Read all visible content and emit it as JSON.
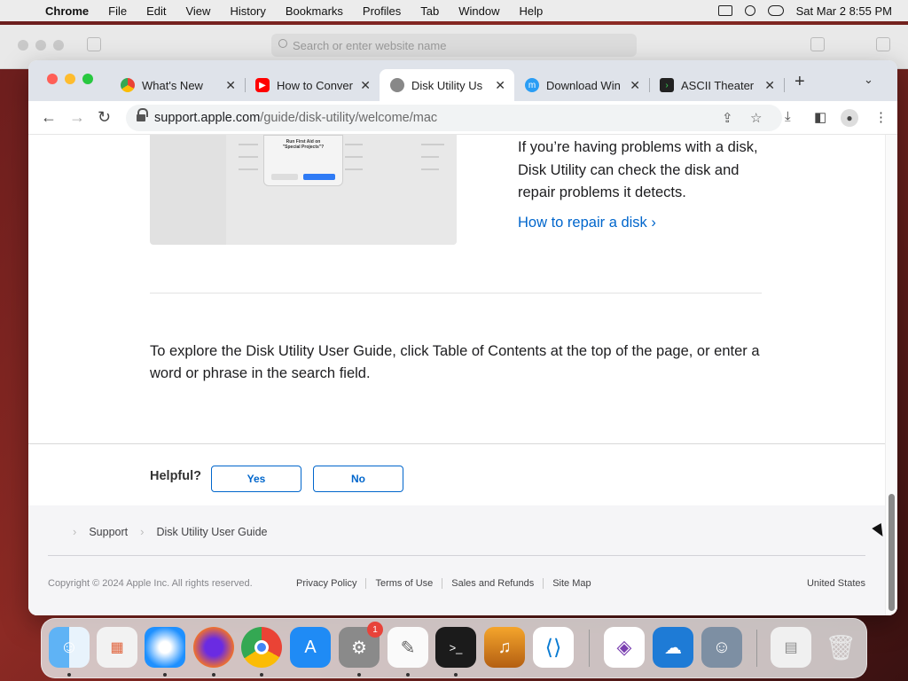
{
  "menubar": {
    "app_name": "Chrome",
    "items": [
      "File",
      "Edit",
      "View",
      "History",
      "Bookmarks",
      "Profiles",
      "Tab",
      "Window",
      "Help"
    ],
    "clock": "Sat Mar 2  8:55 PM"
  },
  "safari": {
    "address_placeholder": "Search or enter website name"
  },
  "tabs": [
    {
      "title": "What's New",
      "icon": "chrome-icon",
      "active": false
    },
    {
      "title": "How to Conver",
      "icon": "youtube-icon",
      "active": false
    },
    {
      "title": "Disk Utility Us",
      "icon": "apple-icon",
      "active": true
    },
    {
      "title": "Download Win",
      "icon": "mu-icon",
      "active": false
    },
    {
      "title": "ASCII Theater",
      "icon": "terminal-prompt-icon",
      "active": false
    }
  ],
  "omnibox": {
    "domain": "support.apple.com",
    "path": "/guide/disk-utility/welcome/mac"
  },
  "content": {
    "dialog_title": "Run First Aid on\n\"Special Projects\"?",
    "side_text": "If you’re having problems with a disk, Disk Utility can check the disk and repair problems it detects.",
    "side_link": "How to repair a disk ›",
    "paragraph": "To explore the Disk Utility User Guide, click Table of Contents at the top of the page, or enter a word or phrase in the search field.",
    "helpful_label": "Helpful?",
    "yes_label": "Yes",
    "no_label": "No"
  },
  "footer": {
    "breadcrumbs": [
      "Support",
      "Disk Utility User Guide"
    ],
    "copyright": "Copyright © 2024 Apple Inc. All rights reserved.",
    "links": [
      "Privacy Policy",
      "Terms of Use",
      "Sales and Refunds",
      "Site Map"
    ],
    "country": "United States"
  },
  "dock": {
    "apps": [
      "Finder",
      "Launchpad",
      "Safari",
      "Firefox",
      "Chrome",
      "App Store",
      "System Preferences",
      "TextEdit",
      "Terminal",
      "GarageBand",
      "Visual Studio Code",
      "Visual Studio",
      "iCloud",
      "Migration Assistant",
      "Preview",
      "Trash"
    ],
    "settings_badge": "1"
  },
  "colors": {
    "link": "#0066cc",
    "tab_strip": "#dfe3ea",
    "footer_bg": "#f5f5f7"
  }
}
